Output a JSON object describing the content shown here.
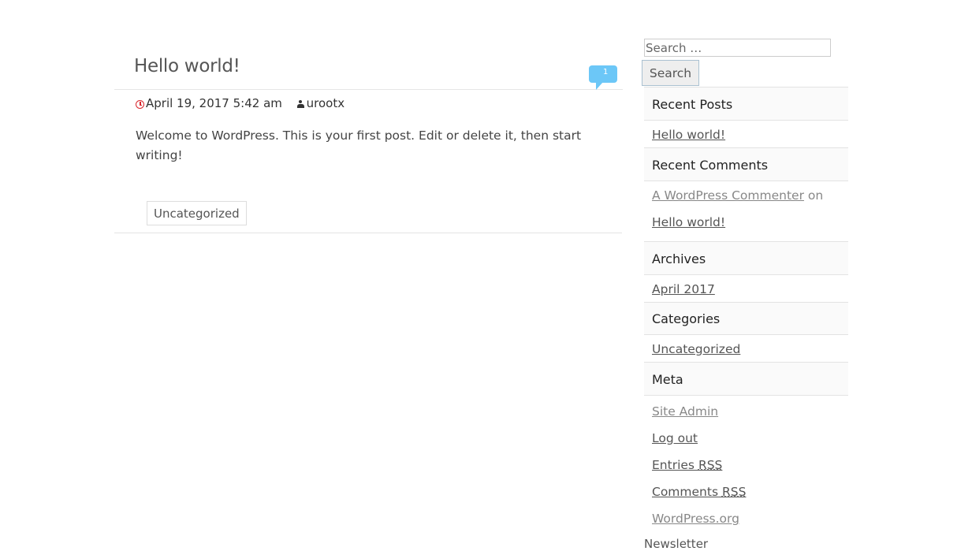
{
  "post": {
    "title": "Hello world!",
    "comment_count": "1",
    "date": "April 19, 2017 5:42 am",
    "author": "urootx",
    "content": "Welcome to WordPress. This is your first post. Edit or delete it, then start writing!",
    "category": "Uncategorized"
  },
  "sidebar": {
    "search": {
      "placeholder": "Search …",
      "value": "",
      "button": "Search"
    },
    "recent_posts": {
      "title": "Recent Posts",
      "items": [
        "Hello world!"
      ]
    },
    "recent_comments": {
      "title": "Recent Comments",
      "author": "A WordPress Commenter",
      "on": "on",
      "post": "Hello world!"
    },
    "archives": {
      "title": "Archives",
      "items": [
        "April 2017"
      ]
    },
    "categories": {
      "title": "Categories",
      "items": [
        "Uncategorized"
      ]
    },
    "meta": {
      "title": "Meta",
      "site_admin": "Site Admin",
      "log_out": "Log out",
      "entries": "Entries",
      "comments": "Comments",
      "rss": "RSS",
      "wordpress_org": "WordPress.org"
    },
    "newsletter_title": "Newsletter"
  },
  "colors": {
    "accent_bubble": "#6cc7f7",
    "clock_icon": "#d9262c"
  }
}
